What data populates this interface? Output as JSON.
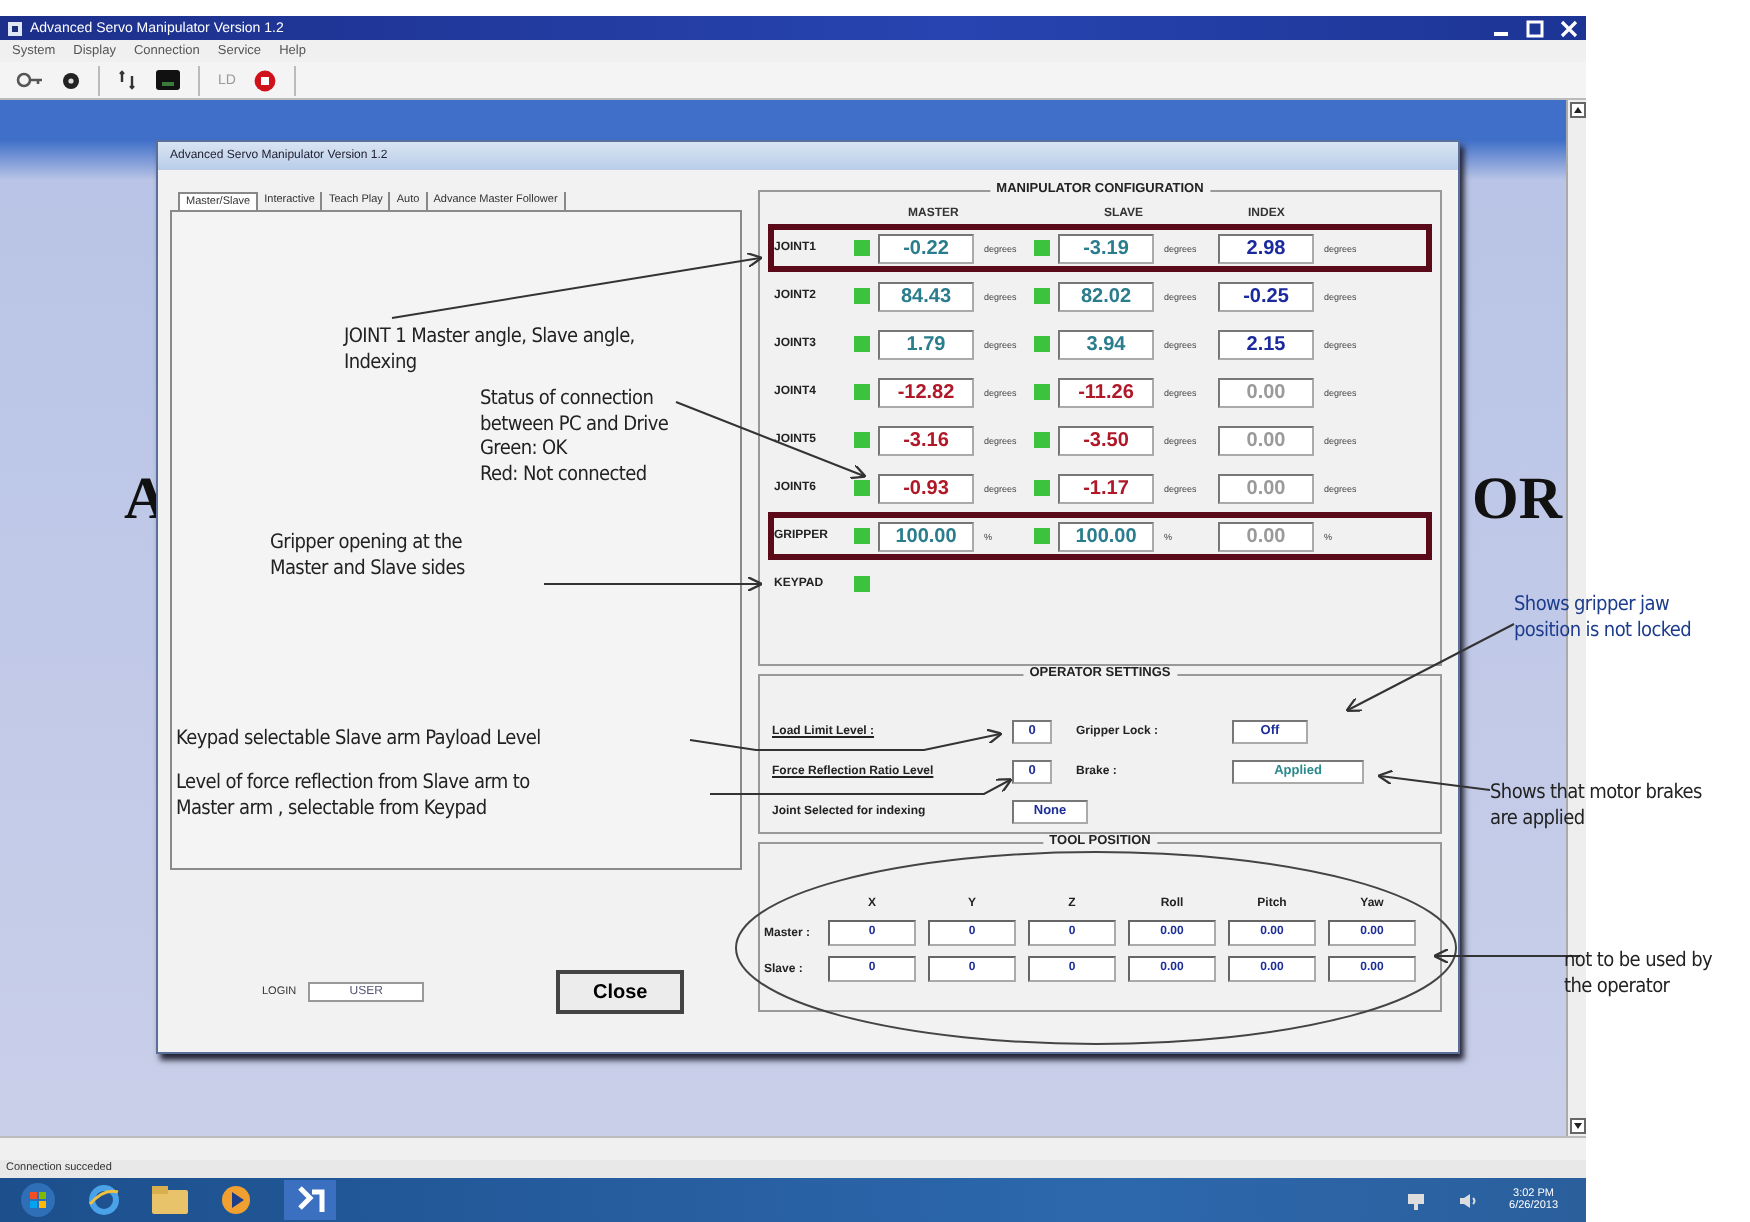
{
  "window": {
    "title": "Advanced Servo Manipulator Version 1.2"
  },
  "menu": [
    "System",
    "Display",
    "Connection",
    "Service",
    "Help"
  ],
  "toolbar": {
    "label": "LD"
  },
  "background_text": [
    "A",
    "OR"
  ],
  "dialog": {
    "title": "Advanced Servo Manipulator Version 1.2",
    "tabs": [
      {
        "label": "Master/Slave",
        "selected": true
      },
      {
        "label": "Interactive",
        "selected": false
      },
      {
        "label": "Teach Play",
        "selected": false
      },
      {
        "label": "Auto",
        "selected": false
      },
      {
        "label": "Advance Master Follower",
        "selected": false
      }
    ],
    "manipulator": {
      "title": "MANIPULATOR CONFIGURATION",
      "columns": [
        "MASTER",
        "SLAVE",
        "INDEX"
      ],
      "rows": [
        {
          "label": "JOINT1",
          "highlighted": true,
          "master": {
            "connected": true,
            "value": "-0.22",
            "color": "#2a7d8c",
            "unit": "degrees"
          },
          "slave": {
            "connected": true,
            "value": "-3.19",
            "color": "#2a7d8c",
            "unit": "degrees"
          },
          "index": {
            "value": "2.98",
            "color": "#1b2a9e",
            "unit": "degrees"
          }
        },
        {
          "label": "JOINT2",
          "highlighted": false,
          "master": {
            "connected": true,
            "value": "84.43",
            "color": "#2a7d8c",
            "unit": "degrees"
          },
          "slave": {
            "connected": true,
            "value": "82.02",
            "color": "#2a7d8c",
            "unit": "degrees"
          },
          "index": {
            "value": "-0.25",
            "color": "#1b2a9e",
            "unit": "degrees"
          }
        },
        {
          "label": "JOINT3",
          "highlighted": false,
          "master": {
            "connected": true,
            "value": "1.79",
            "color": "#2a7d8c",
            "unit": "degrees"
          },
          "slave": {
            "connected": true,
            "value": "3.94",
            "color": "#2a7d8c",
            "unit": "degrees"
          },
          "index": {
            "value": "2.15",
            "color": "#1b2a9e",
            "unit": "degrees"
          }
        },
        {
          "label": "JOINT4",
          "highlighted": false,
          "master": {
            "connected": true,
            "value": "-12.82",
            "color": "#b01828",
            "unit": "degrees"
          },
          "slave": {
            "connected": true,
            "value": "-11.26",
            "color": "#b01828",
            "unit": "degrees"
          },
          "index": {
            "value": "0.00",
            "color": "#9a9a9a",
            "unit": "degrees"
          }
        },
        {
          "label": "JOINT5",
          "highlighted": false,
          "master": {
            "connected": true,
            "value": "-3.16",
            "color": "#b01828",
            "unit": "degrees"
          },
          "slave": {
            "connected": true,
            "value": "-3.50",
            "color": "#b01828",
            "unit": "degrees"
          },
          "index": {
            "value": "0.00",
            "color": "#9a9a9a",
            "unit": "degrees"
          }
        },
        {
          "label": "JOINT6",
          "highlighted": false,
          "master": {
            "connected": true,
            "value": "-0.93",
            "color": "#b01828",
            "unit": "degrees"
          },
          "slave": {
            "connected": true,
            "value": "-1.17",
            "color": "#b01828",
            "unit": "degrees"
          },
          "index": {
            "value": "0.00",
            "color": "#9a9a9a",
            "unit": "degrees"
          }
        },
        {
          "label": "GRIPPER",
          "highlighted": true,
          "master": {
            "connected": true,
            "value": "100.00",
            "color": "#2a7d8c",
            "unit": "%"
          },
          "slave": {
            "connected": true,
            "value": "100.00",
            "color": "#2a7d8c",
            "unit": "%"
          },
          "index": {
            "value": "0.00",
            "color": "#9a9a9a",
            "unit": "%"
          }
        }
      ],
      "keypad": {
        "label": "KEYPAD",
        "connected": true
      }
    },
    "operator_settings": {
      "title": "OPERATOR SETTINGS",
      "load_limit": {
        "label": "Load Limit Level :",
        "value": "0"
      },
      "gripper_lock": {
        "label": "Gripper Lock :",
        "value": "Off"
      },
      "force_reflection": {
        "label": "Force Reflection Ratio Level",
        "value": "0"
      },
      "brake": {
        "label": "Brake :",
        "value": "Applied"
      },
      "joint_indexing": {
        "label": "Joint Selected for indexing",
        "value": "None"
      }
    },
    "tool_position": {
      "title": "TOOL POSITION",
      "columns": [
        "X",
        "Y",
        "Z",
        "Roll",
        "Pitch",
        "Yaw"
      ],
      "rows": [
        {
          "label": "Master :",
          "values": [
            "0",
            "0",
            "0",
            "0.00",
            "0.00",
            "0.00"
          ]
        },
        {
          "label": "Slave :",
          "values": [
            "0",
            "0",
            "0",
            "0.00",
            "0.00",
            "0.00"
          ]
        }
      ]
    },
    "login": {
      "label": "LOGIN",
      "value": "USER"
    },
    "close_button": "Close"
  },
  "status_bar": "Connection succeded",
  "taskbar": {
    "time": "3:02 PM",
    "date": "6/26/2013"
  },
  "annotations": [
    {
      "lines": [
        "JOINT 1 Master angle, Slave angle,",
        "Indexing"
      ],
      "color": "#222222"
    },
    {
      "lines": [
        "Status of connection",
        "between PC and Drive",
        "Green: OK",
        "Red: Not connected"
      ],
      "color": "#222222"
    },
    {
      "lines": [
        "Gripper opening at the",
        "Master and Slave sides"
      ],
      "color": "#222222"
    },
    {
      "lines": [
        "Keypad selectable Slave arm Payload Level"
      ],
      "color": "#222222"
    },
    {
      "lines": [
        "Level of force reflection from Slave arm to",
        "Master arm , selectable from Keypad"
      ],
      "color": "#222222"
    },
    {
      "lines": [
        "Shows gripper jaw",
        "position is not locked"
      ],
      "color": "#1d3c8c"
    },
    {
      "lines": [
        "Shows that motor brakes",
        "are applied"
      ],
      "color": "#222222"
    },
    {
      "lines": [
        "not to be used by",
        "the operator"
      ],
      "color": "#222222"
    }
  ]
}
